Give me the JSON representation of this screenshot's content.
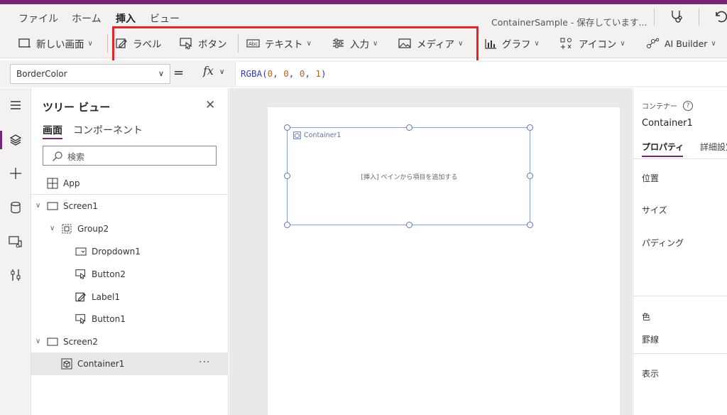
{
  "menubar": {
    "items": [
      "ファイル",
      "ホーム",
      "挿入",
      "ビュー"
    ],
    "status": "ContainerSample - 保存しています..."
  },
  "ribbon": {
    "new_screen": "新しい画面",
    "label": "ラベル",
    "button": "ボタン",
    "text": "テキスト",
    "input": "入力",
    "media": "メディア",
    "chart": "グラフ",
    "icon": "アイコン",
    "ai_builder": "AI Builder"
  },
  "formula": {
    "property": "BorderColor",
    "fx": "fx",
    "expr_fn": "RGBA(",
    "expr_args": [
      "0",
      "0",
      "0",
      "1"
    ],
    "expr_close": ")"
  },
  "tree": {
    "title": "ツリー ビュー",
    "tabs": [
      "画面",
      "コンポーネント"
    ],
    "search_placeholder": "検索",
    "app": "App",
    "items": {
      "screen1": "Screen1",
      "group2": "Group2",
      "dropdown1": "Dropdown1",
      "button2": "Button2",
      "label1": "Label1",
      "button1": "Button1",
      "screen2": "Screen2",
      "container1": "Container1"
    },
    "more": "···"
  },
  "canvas": {
    "container_label": "Container1",
    "container_hint": "[挿入] ペインから項目を追加する"
  },
  "properties": {
    "type": "コンテナー",
    "help": "?",
    "name": "Container1",
    "tabs": [
      "プロパティ",
      "詳細設定"
    ],
    "rows": [
      "位置",
      "サイズ",
      "パディング",
      "色",
      "罫線",
      "表示"
    ]
  },
  "colors": {
    "brand": "#742774",
    "highlight": "#e3242b",
    "selection": "#5b75b8"
  }
}
